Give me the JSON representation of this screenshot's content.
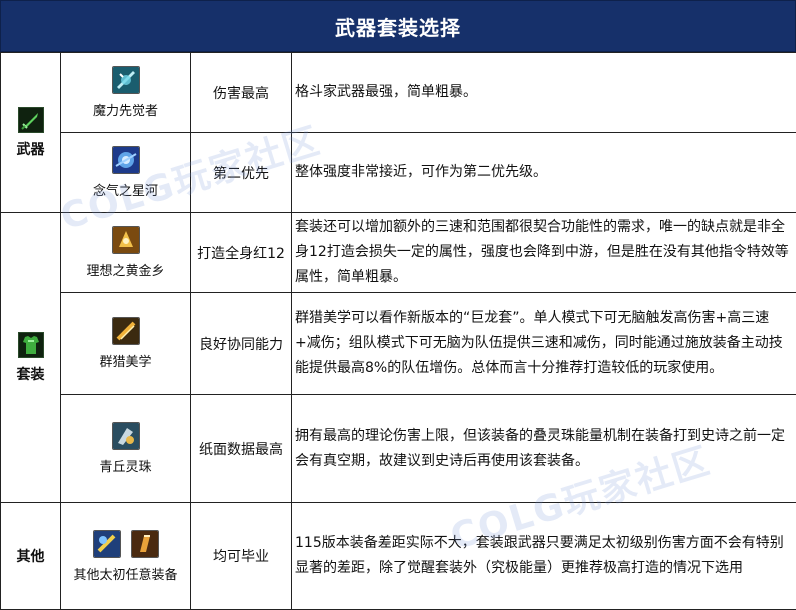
{
  "title": "武器套装选择",
  "watermark": "COLG玩家社区",
  "rows": [
    {
      "category": "武器",
      "category_icon": "sword-icon",
      "item": "魔力先觉者",
      "item_icons": [
        "mana-crystal-icon"
      ],
      "tag": "伤害最高",
      "desc": "格斗家武器最强，简单粗暴。"
    },
    {
      "item": "念气之星河",
      "item_icons": [
        "star-galaxy-icon"
      ],
      "tag": "第二优先",
      "desc": "整体强度非常接近，可作为第二优先级。"
    },
    {
      "category": "套装",
      "category_icon": "armor-icon",
      "item": "理想之黄金乡",
      "item_icons": [
        "golden-land-icon"
      ],
      "tag": "打造全身红12",
      "desc": "套装还可以增加额外的三速和范围都很契合功能性的需求，唯一的缺点就是非全身12打造会损失一定的属性，强度也会降到中游，但是胜在没有其他指令特效等属性，简单粗暴。"
    },
    {
      "item": "群猎美学",
      "item_icons": [
        "hunting-icon"
      ],
      "tag": "良好协同能力",
      "desc": "群猎美学可以看作新版本的“巨龙套”。单人模式下可无脑触发高伤害+高三速+减伤；组队模式下可无脑为队伍提供三速和减伤，同时能通过施放装备主动技能提供最高8%的队伍增伤。总体而言十分推荐打造较低的玩家使用。"
    },
    {
      "item": "青丘灵珠",
      "item_icons": [
        "spirit-orb-icon"
      ],
      "tag": "纸面数据最高",
      "desc": "拥有最高的理论伤害上限，但该装备的叠灵珠能量机制在装备打到史诗之前一定会有真空期，故建议到史诗后再使用该套装备。"
    },
    {
      "category": "其他",
      "item": "其他太初任意装备",
      "item_icons": [
        "primordial-gear-icon-1",
        "primordial-gear-icon-2"
      ],
      "tag": "均可毕业",
      "desc": "115版本装备差距实际不大，套装跟武器只要满足太初级别伤害方面不会有特别显著的差距，除了觉醒套装外（究极能量）更推荐极高打造的情况下选用"
    }
  ]
}
